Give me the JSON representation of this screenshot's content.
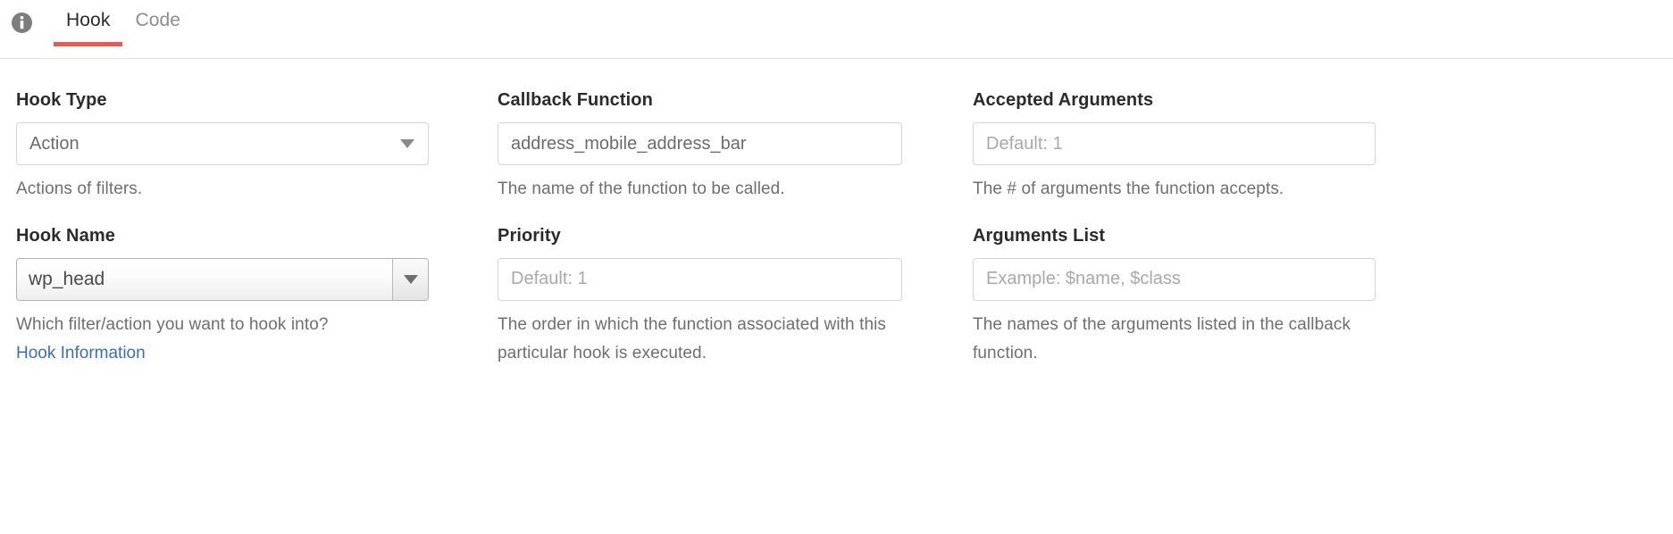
{
  "tabbar": {
    "info_icon": "info-circle-icon",
    "tabs": [
      {
        "label": "Hook",
        "active": true
      },
      {
        "label": "Code",
        "active": false
      }
    ]
  },
  "colors": {
    "accent_underline": "#ea5a54",
    "link": "#3a6fb5",
    "label_text": "#2b2b2b",
    "help_text": "#6f6f6f",
    "input_border": "#d6d6d6",
    "placeholder": "#a9a9a9"
  },
  "form": {
    "col1": {
      "hook_type": {
        "label": "Hook Type",
        "value": "Action",
        "caret_icon": "chevron-down-icon",
        "help": "Actions of filters."
      },
      "hook_name": {
        "label": "Hook Name",
        "value": "wp_head",
        "caret_icon": "chevron-down-icon",
        "help": "Which filter/action you want to hook into?",
        "link_label": "Hook Information"
      }
    },
    "col2": {
      "callback_function": {
        "label": "Callback Function",
        "value": "address_mobile_address_bar",
        "placeholder": "",
        "help": "The name of the function to be called."
      },
      "priority": {
        "label": "Priority",
        "value": "",
        "placeholder": "Default: 1",
        "help": "The order in which the function associated with this particular hook is executed."
      }
    },
    "col3": {
      "accepted_arguments": {
        "label": "Accepted Arguments",
        "value": "",
        "placeholder": "Default: 1",
        "help": "The # of arguments the function accepts."
      },
      "arguments_list": {
        "label": "Arguments List",
        "value": "",
        "placeholder": "Example: $name, $class",
        "help": "The names of the arguments listed in the callback function."
      }
    }
  }
}
